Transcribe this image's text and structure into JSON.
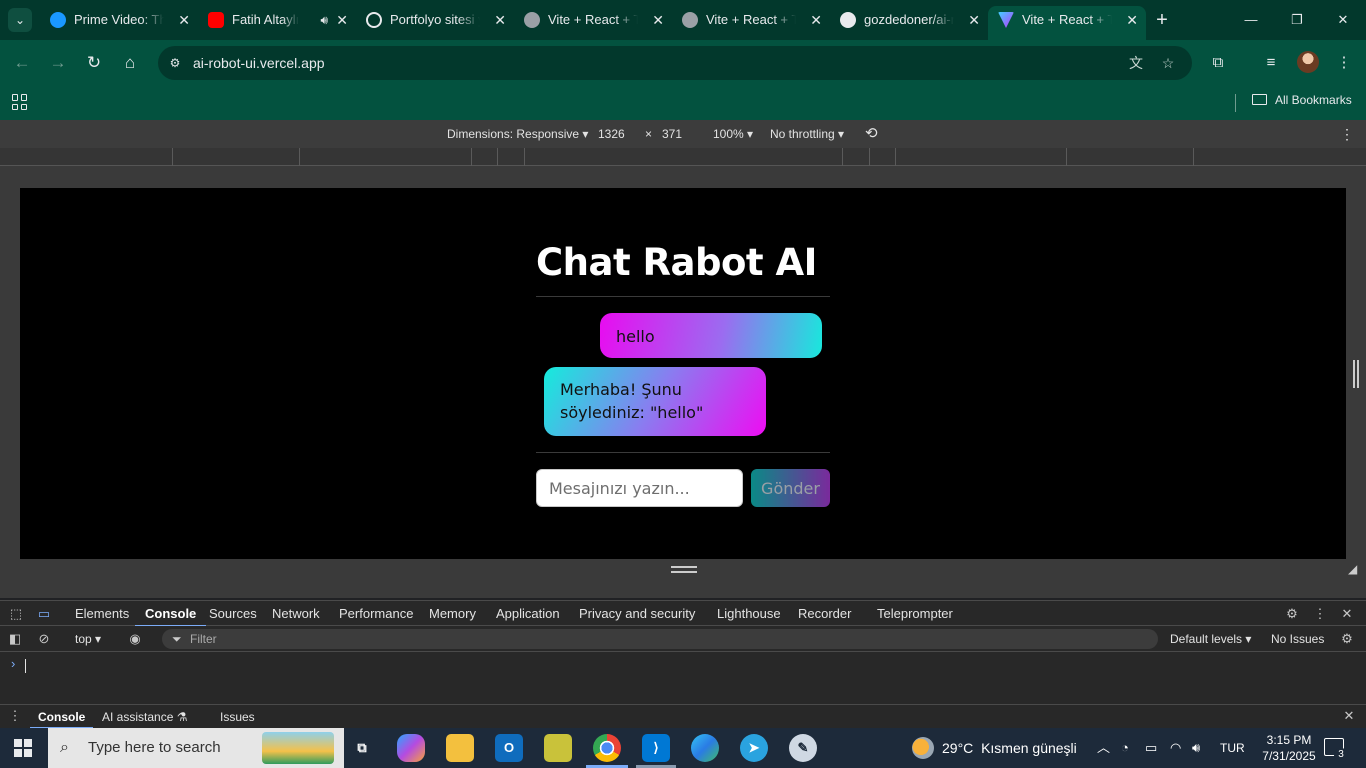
{
  "browser": {
    "tabs": [
      {
        "title": "Prime Video: The",
        "icon": "prime-video-icon",
        "color": "#1a98ff"
      },
      {
        "title": "Fatih Altaylı",
        "icon": "youtube-icon",
        "color": "#ff0000",
        "audio": true
      },
      {
        "title": "Portfolyo sitesi y",
        "icon": "chatgpt-icon",
        "color": "#e8eaed"
      },
      {
        "title": "Vite + React + T",
        "icon": "globe-icon",
        "color": "#e8eaed"
      },
      {
        "title": "Vite + React + T",
        "icon": "globe-icon",
        "color": "#e8eaed"
      },
      {
        "title": "gozdedoner/ai-r",
        "icon": "github-icon",
        "color": "#e8eaed"
      },
      {
        "title": "Vite + React + T",
        "icon": "vite-icon",
        "color": "#bd34fe",
        "active": true
      }
    ],
    "url": "ai-robot-ui.vercel.app",
    "bookmarks_label": "All Bookmarks",
    "accent_color": "#03523f"
  },
  "device_toolbar": {
    "dimensions_label": "Dimensions: Responsive",
    "width": "1326",
    "times": "×",
    "height": "371",
    "zoom": "100%",
    "throttling": "No throttling"
  },
  "app": {
    "title": "Chat Rabot AI",
    "messages": [
      {
        "role": "user",
        "text": "hello"
      },
      {
        "role": "bot",
        "text": "Merhaba! Şunu söylediniz: \"hello\""
      }
    ],
    "input_placeholder": "Mesajınızı yazın...",
    "send_label": "Gönder"
  },
  "devtools": {
    "tabs": [
      "Elements",
      "Console",
      "Sources",
      "Network",
      "Performance",
      "Memory",
      "Application",
      "Privacy and security",
      "Lighthouse",
      "Recorder",
      "Teleprompter"
    ],
    "active_tab": "Console",
    "context": "top",
    "filter_placeholder": "Filter",
    "levels": "Default levels",
    "issues": "No Issues",
    "prompt": "›",
    "drawer_tabs": [
      "Console",
      "AI assistance",
      "Issues"
    ]
  },
  "taskbar": {
    "search_placeholder": "Type here to search",
    "weather_temp": "29°C",
    "weather_desc": "Kısmen güneşli",
    "language": "TUR",
    "time": "3:15 PM",
    "date": "7/31/2025",
    "notification_count": "3"
  }
}
